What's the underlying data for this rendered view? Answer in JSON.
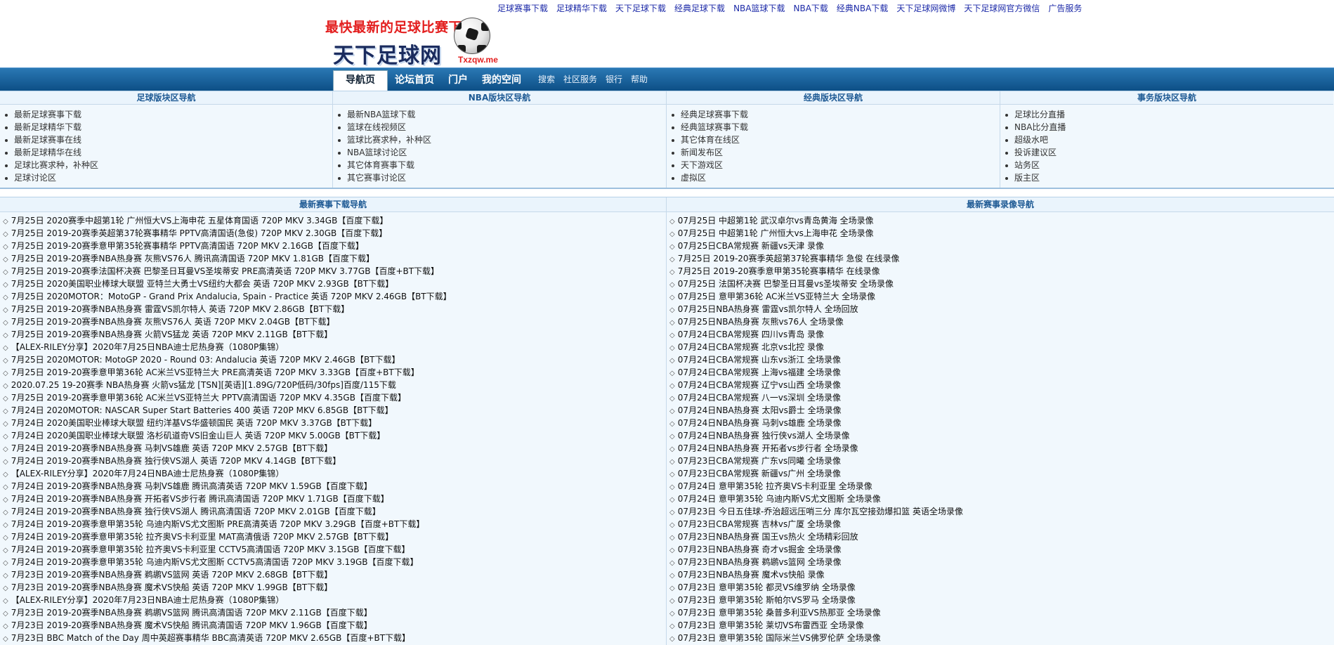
{
  "header": {
    "slogan": "最快最新的足球比赛下载",
    "brand": "天下足球网",
    "site": "Txzqw.me",
    "top_links": [
      "足球赛事下载",
      "足球精华下载",
      "天下足球下载",
      "经典足球下载",
      "NBA篮球下载",
      "NBA下载",
      "经典NBA下载",
      "天下足球网微博",
      "天下足球网官方微信",
      "广告服务"
    ]
  },
  "navbar": {
    "tabs": [
      {
        "label": "导航页",
        "active": true
      },
      {
        "label": "论坛首页",
        "active": false
      },
      {
        "label": "门户",
        "active": false
      },
      {
        "label": "我的空间",
        "active": false
      }
    ],
    "small_links": [
      "搜索",
      "社区服务",
      "银行",
      "帮助"
    ]
  },
  "categories": [
    {
      "title": "足球版块区导航",
      "items": [
        "最新足球赛事下载",
        "最新足球精华下载",
        "最新足球赛事在线",
        "最新足球精华在线",
        "足球比赛求种，补种区",
        "足球讨论区"
      ]
    },
    {
      "title": "NBA版块区导航",
      "items": [
        "最新NBA篮球下载",
        "篮球在线视频区",
        "篮球比赛求种，补种区",
        "NBA篮球讨论区",
        "其它体育赛事下载",
        "其它赛事讨论区"
      ]
    },
    {
      "title": "经典版块区导航",
      "items": [
        "经典足球赛事下载",
        "经典篮球赛事下载",
        "其它体育在线区",
        "新闻发布区",
        "天下游戏区",
        "虚拟区"
      ]
    },
    {
      "title": "事务版块区导航",
      "items": [
        "足球比分直播",
        "NBA比分直播",
        "超级水吧",
        "投诉建议区",
        "站务区",
        "版主区"
      ]
    }
  ],
  "downloads": {
    "title": "最新赛事下载导航",
    "items": [
      "7月25日 2020赛季中超第1轮 广州恒大VS上海申花 五星体育国语 720P MKV 3.34GB【百度下载】",
      "7月25日 2019-20赛季英超第37轮赛事精华 PPTV高清国语(急俊) 720P MKV 2.30GB【百度下载】",
      "7月25日 2019-20赛季意甲第35轮赛事精华 PPTV高清国语 720P MKV 2.16GB【百度下载】",
      "7月25日 2019-20赛季NBA热身赛 灰熊VS76人 腾讯高清国语 720P MKV 1.81GB【百度下载】",
      "7月25日 2019-20赛季法国杯决赛 巴黎圣日耳曼VS圣埃蒂安 PRE高清英语 720P MKV 3.77GB【百度+BT下载】",
      "7月25日 2020美国职业棒球大联盟 亚特兰大勇士VS纽约大都会 英语 720P MKV 2.93GB【BT下载】",
      "7月25日 2020MOTOR：MotoGP - Grand Prix Andalucia, Spain - Practice 英语 720P MKV 2.46GB【BT下载】",
      "7月25日 2019-20赛季NBA热身赛 雷霆VS凯尔特人 英语 720P MKV 2.86GB【BT下载】",
      "7月25日 2019-20赛季NBA热身赛 灰熊VS76人 英语 720P MKV 2.04GB【BT下载】",
      "7月25日 2019-20赛季NBA热身赛 火箭VS猛龙 英语 720P MKV 2.11GB【BT下载】",
      "【ALEX-RILEY分享】2020年7月25日NBA迪士尼热身赛（1080P集锦）",
      "7月25日 2020MOTOR: MotoGP 2020 - Round 03: Andalucia 英语 720P MKV 2.46GB【BT下载】",
      "7月25日 2019-20赛季意甲第36轮 AC米兰VS亚特兰大 PRE高清英语 720P MKV 3.33GB【百度+BT下载】",
      "2020.07.25 19-20赛季 NBA热身赛 火箭vs猛龙 [TSN][英语][1.89G/720P低码/30fps]百度/115下载",
      "7月25日 2019-20赛季意甲第36轮 AC米兰VS亚特兰大 PPTV高清国语 720P MKV 4.35GB【百度下载】",
      "7月24日 2020MOTOR: NASCAR Super Start Batteries 400 英语 720P MKV 6.85GB【BT下载】",
      "7月24日 2020美国职业棒球大联盟 纽约洋基VS华盛顿国民 英语 720P MKV 3.37GB【BT下载】",
      "7月24日 2020美国职业棒球大联盟 洛杉矶道奇VS旧金山巨人 英语 720P MKV 5.00GB【BT下载】",
      "7月24日 2019-20赛季NBA热身赛 马刺VS雄鹿 英语 720P MKV 2.57GB【BT下载】",
      "7月24日 2019-20赛季NBA热身赛 独行侠VS湖人 英语 720P MKV 4.14GB【BT下载】",
      "【ALEX-RILEY分享】2020年7月24日NBA迪士尼热身赛（1080P集锦）",
      "7月24日 2019-20赛季NBA热身赛 马刺VS雄鹿 腾讯高清英语 720P MKV 1.59GB【百度下载】",
      "7月24日 2019-20赛季NBA热身赛 开拓者VS步行者 腾讯高清国语 720P MKV 1.71GB【百度下载】",
      "7月24日 2019-20赛季NBA热身赛 独行侠VS湖人 腾讯高清国语 720P MKV 2.01GB【百度下载】",
      "7月24日 2019-20赛季意甲第35轮 乌迪内斯VS尤文图斯 PRE高清英语 720P MKV 3.29GB【百度+BT下载】",
      "7月24日 2019-20赛季意甲第35轮 拉齐奥VS卡利亚里 MAT高清俄语 720P MKV 2.57GB【BT下载】",
      "7月24日 2019-20赛季意甲第35轮 拉齐奥VS卡利亚里 CCTV5高清国语 720P MKV 3.15GB【百度下载】",
      "7月24日 2019-20赛季意甲第35轮 乌迪内斯VS尤文图斯 CCTV5高清国语 720P MKV 3.19GB【百度下载】",
      "7月23日 2019-20赛季NBA热身赛 鹈鹕VS篮网 英语 720P MKV 2.68GB【BT下载】",
      "7月23日 2019-20赛季NBA热身赛 魔术VS快船 英语 720P MKV 1.99GB【BT下载】",
      "【ALEX-RILEY分享】2020年7月23日NBA迪士尼热身赛（1080P集锦）",
      "7月23日 2019-20赛季NBA热身赛 鹈鹕VS篮网 腾讯高清国语 720P MKV 2.11GB【百度下载】",
      "7月23日 2019-20赛季NBA热身赛 魔术VS快船 腾讯高清国语 720P MKV 1.96GB【百度下载】",
      "7月23日 BBC Match of the Day 周中英超赛事精华 BBC高清英语 720P MKV 2.65GB【百度+BT下载】"
    ]
  },
  "replays": {
    "title": "最新赛事录像导航",
    "items": [
      "07月25日 中超第1轮 武汉卓尔vs青岛黄海 全场录像",
      "07月25日 中超第1轮 广州恒大vs上海申花 全场录像",
      "07月25日CBA常规赛 新疆vs天津 录像",
      "7月25日 2019-20赛季英超第37轮赛事精华 急俊 在线录像",
      "7月25日 2019-20赛季意甲第35轮赛事精华 在线录像",
      "07月25日 法国杯决赛 巴黎圣日耳曼vs圣埃蒂安 全场录像",
      "07月25日 意甲第36轮 AC米兰VS亚特兰大 全场录像",
      "07月25日NBA热身赛 雷霆vs凯尔特人 全场回放",
      "07月25日NBA热身赛 灰熊vs76人 全场录像",
      "07月24日CBA常规赛 四川vs青岛 录像",
      "07月24日CBA常规赛 北京vs北控 录像",
      "07月24日CBA常规赛 山东vs浙江 全场录像",
      "07月24日CBA常规赛 上海vs福建 全场录像",
      "07月24日CBA常规赛 辽宁vs山西 全场录像",
      "07月24日CBA常规赛 八一vs深圳 全场录像",
      "07月24日NBA热身赛 太阳vs爵士 全场录像",
      "07月24日NBA热身赛 马刺vs雄鹿 全场录像",
      "07月24日NBA热身赛 独行侠vs湖人 全场录像",
      "07月24日NBA热身赛 开拓者vs步行者 全场录像",
      "07月23日CBA常规赛 广东vs同曦 全场录像",
      "07月23日CBA常规赛 新疆vs广州 全场录像",
      "07月24日 意甲第35轮 拉齐奥VS卡利亚里 全场录像",
      "07月24日 意甲第35轮 乌迪内斯VS尤文图斯 全场录像",
      "07月23日 今日五佳球-乔治超远压哨三分 库尔瓦空接劲爆扣篮 英语全场录像",
      "07月23日CBA常规赛 吉林vs广厦 全场录像",
      "07月23日NBA热身赛 国王vs热火 全场精彩回放",
      "07月23日NBA热身赛 奇才vs掘金 全场录像",
      "07月23日NBA热身赛 鹈鹕vs篮网 全场录像",
      "07月23日NBA热身赛 魔术vs快船 录像",
      "07月23日 意甲第35轮 都灵VS维罗纳 全场录像",
      "07月23日 意甲第35轮 斯帕尔VS罗马 全场录像",
      "07月23日 意甲第35轮 桑普多利亚VS热那亚 全场录像",
      "07月23日 意甲第35轮 莱切VS布雷西亚 全场录像",
      "07月23日 意甲第35轮 国际米兰VS佛罗伦萨 全场录像"
    ]
  }
}
